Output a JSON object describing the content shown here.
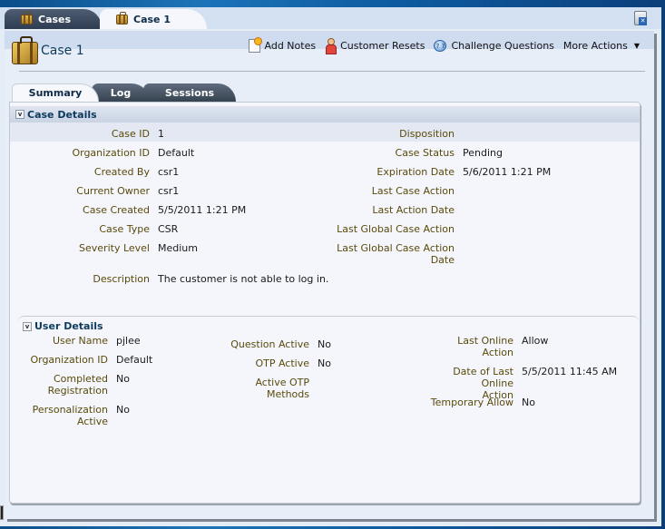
{
  "top_tabs": [
    {
      "label": "Cases",
      "icon": "briefcase-icon",
      "active": false
    },
    {
      "label": "Case 1",
      "icon": "briefcase-icon",
      "active": true
    }
  ],
  "close_tab_icon": "close-tab-icon",
  "page_title": "Case 1",
  "actions": [
    {
      "label": "Add Notes",
      "icon": "add-note-icon"
    },
    {
      "label": "Customer Resets",
      "icon": "person-icon"
    },
    {
      "label": "Challenge Questions",
      "icon": "question-icon"
    },
    {
      "label": "More Actions",
      "icon": "chevron-down-icon"
    }
  ],
  "sub_tabs": [
    {
      "label": "Summary",
      "active": true
    },
    {
      "label": "Log",
      "active": false
    },
    {
      "label": "Sessions",
      "active": false
    }
  ],
  "case_details": {
    "title": "Case Details",
    "left": [
      {
        "label": "Case ID",
        "value": "1"
      },
      {
        "label": "Organization ID",
        "value": "Default"
      },
      {
        "label": "Created By",
        "value": "csr1"
      },
      {
        "label": "Current Owner",
        "value": "csr1"
      },
      {
        "label": "Case Created",
        "value": "5/5/2011 1:21 PM"
      },
      {
        "label": "Case Type",
        "value": "CSR"
      },
      {
        "label": "Severity Level",
        "value": "Medium"
      },
      {
        "label": "Description",
        "value": "The customer is not able to log in."
      }
    ],
    "right": [
      {
        "label": "Disposition",
        "value": ""
      },
      {
        "label": "Case Status",
        "value": "Pending"
      },
      {
        "label": "Expiration Date",
        "value": "5/6/2011 1:21 PM"
      },
      {
        "label": "Last Case Action",
        "value": ""
      },
      {
        "label": "Last Action Date",
        "value": ""
      },
      {
        "label": "Last Global Case Action",
        "value": ""
      },
      {
        "label": "Last Global Case Action Date",
        "value": ""
      }
    ]
  },
  "user_details": {
    "title": "User Details",
    "col1": [
      {
        "label": "User Name",
        "value": "pjlee"
      },
      {
        "label": "Organization ID",
        "value": "Default"
      },
      {
        "label": "Completed Registration",
        "value": "No"
      },
      {
        "label": "Personalization Active",
        "value": "No"
      }
    ],
    "col2": [
      {
        "label": "Question Active",
        "value": "No"
      },
      {
        "label": "OTP Active",
        "value": "No"
      },
      {
        "label": "Active OTP Methods",
        "value": ""
      }
    ],
    "col3": [
      {
        "label": "Last Online Action",
        "value": "Allow"
      },
      {
        "label": "Date of Last Online Action",
        "value": "5/5/2011 11:45 AM"
      },
      {
        "label": "Temporary Allow",
        "value": "No"
      }
    ]
  },
  "colors": {
    "label": "#5a4a0a",
    "header_text": "#0d3a5c",
    "active_tab_bg": "#f6f8fc",
    "inactive_tab_bg": "#3f4b5a"
  }
}
